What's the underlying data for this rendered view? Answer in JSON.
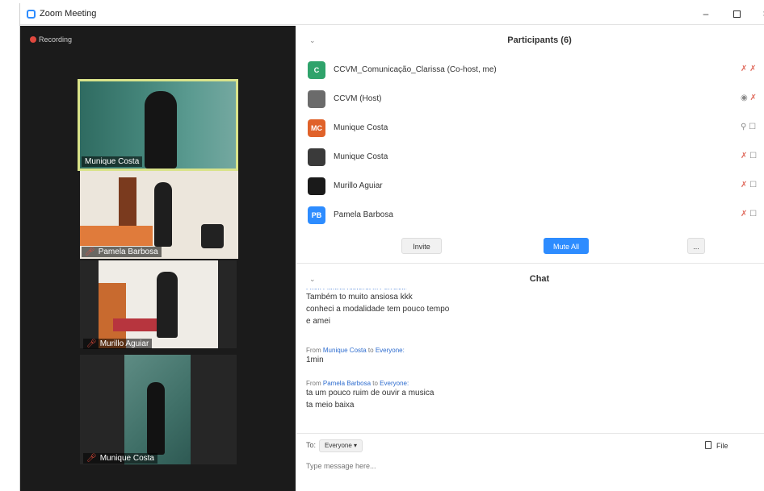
{
  "window": {
    "title": "Zoom Meeting",
    "minimize": "–",
    "close": "×"
  },
  "video": {
    "recording_label": "Recording",
    "tiles": [
      {
        "name": "Munique Costa"
      },
      {
        "name": "Pamela Barbosa"
      },
      {
        "name": "Murillo Aguiar"
      },
      {
        "name": "Munique Costa"
      }
    ]
  },
  "participants": {
    "title": "Participants (6)",
    "rows": [
      {
        "initials": "C",
        "name": "CCVM_Comunicação_Clarissa (Co-host, me)",
        "avatar_color": "#2fa36b"
      },
      {
        "initials": "",
        "name": "CCVM (Host)",
        "avatar_color": "#6b6b6b"
      },
      {
        "initials": "MC",
        "name": "Munique Costa",
        "avatar_color": "#e0622a"
      },
      {
        "initials": "",
        "name": "Munique Costa",
        "avatar_color": "#3a3a3a"
      },
      {
        "initials": "",
        "name": "Murillo Aguiar",
        "avatar_color": "#1a1a1a"
      },
      {
        "initials": "PB",
        "name": "Pamela Barbosa",
        "avatar_color": "#2d8cff"
      }
    ],
    "invite_label": "Invite",
    "mute_all_label": "Mute All",
    "more_label": "..."
  },
  "chat": {
    "title": "Chat",
    "messages": [
      {
        "from_prefix": "",
        "from_name": "",
        "to_prefix": "",
        "to_name": "",
        "lines": [
          "Também to muito ansiosa kkk",
          "conheci a modalidade tem pouco tempo",
          "e amei"
        ]
      },
      {
        "from_prefix": "From ",
        "from_name": "Munique Costa",
        "to_prefix": " to ",
        "to_name": "Everyone",
        "lines": [
          "1min"
        ]
      },
      {
        "from_prefix": "From ",
        "from_name": "Pamela Barbosa",
        "to_prefix": " to ",
        "to_name": "Everyone",
        "lines": [
          "ta um pouco ruim de ouvir a musica",
          "ta meio baixa"
        ]
      }
    ],
    "to_label": "To:",
    "to_value": "Everyone ▾",
    "file_label": "File",
    "input_placeholder": "Type message here..."
  }
}
